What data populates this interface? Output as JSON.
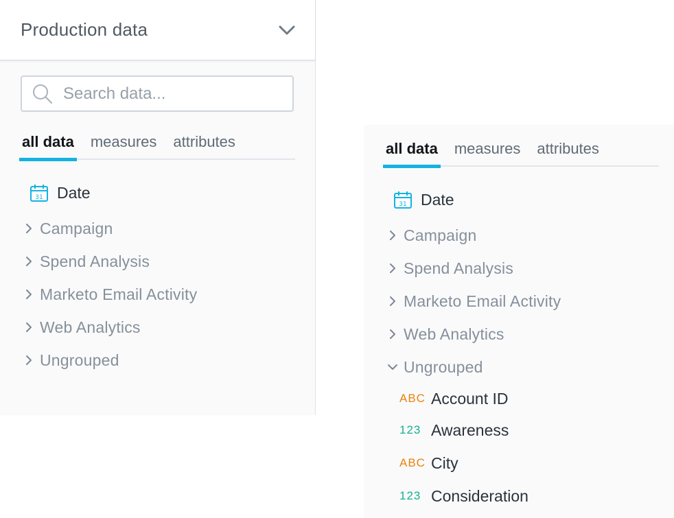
{
  "left": {
    "dataset_title": "Production data",
    "search": {
      "placeholder": "Search data..."
    },
    "tabs": [
      {
        "label": "all data",
        "active": true
      },
      {
        "label": "measures",
        "active": false
      },
      {
        "label": "attributes",
        "active": false
      }
    ],
    "date_label": "Date",
    "groups": [
      {
        "label": "Campaign",
        "expanded": false
      },
      {
        "label": "Spend Analysis",
        "expanded": false
      },
      {
        "label": "Marketo Email Activity",
        "expanded": false
      },
      {
        "label": "Web Analytics",
        "expanded": false
      },
      {
        "label": "Ungrouped",
        "expanded": false
      }
    ]
  },
  "right": {
    "tabs": [
      {
        "label": "all data",
        "active": true
      },
      {
        "label": "measures",
        "active": false
      },
      {
        "label": "attributes",
        "active": false
      }
    ],
    "date_label": "Date",
    "groups": [
      {
        "label": "Campaign",
        "expanded": false
      },
      {
        "label": "Spend Analysis",
        "expanded": false
      },
      {
        "label": "Marketo Email Activity",
        "expanded": false
      },
      {
        "label": "Web Analytics",
        "expanded": false
      },
      {
        "label": "Ungrouped",
        "expanded": true
      }
    ],
    "fields": [
      {
        "type": "ABC",
        "kind": "attribute",
        "label": "Account ID"
      },
      {
        "type": "123",
        "kind": "fact",
        "label": "Awareness"
      },
      {
        "type": "ABC",
        "kind": "attribute",
        "label": "City"
      },
      {
        "type": "123",
        "kind": "fact",
        "label": "Consideration"
      }
    ]
  },
  "calendar_day": "31",
  "colors": {
    "accent": "#14b2e2",
    "attribute": "#e8830c",
    "fact": "#14b28e"
  }
}
